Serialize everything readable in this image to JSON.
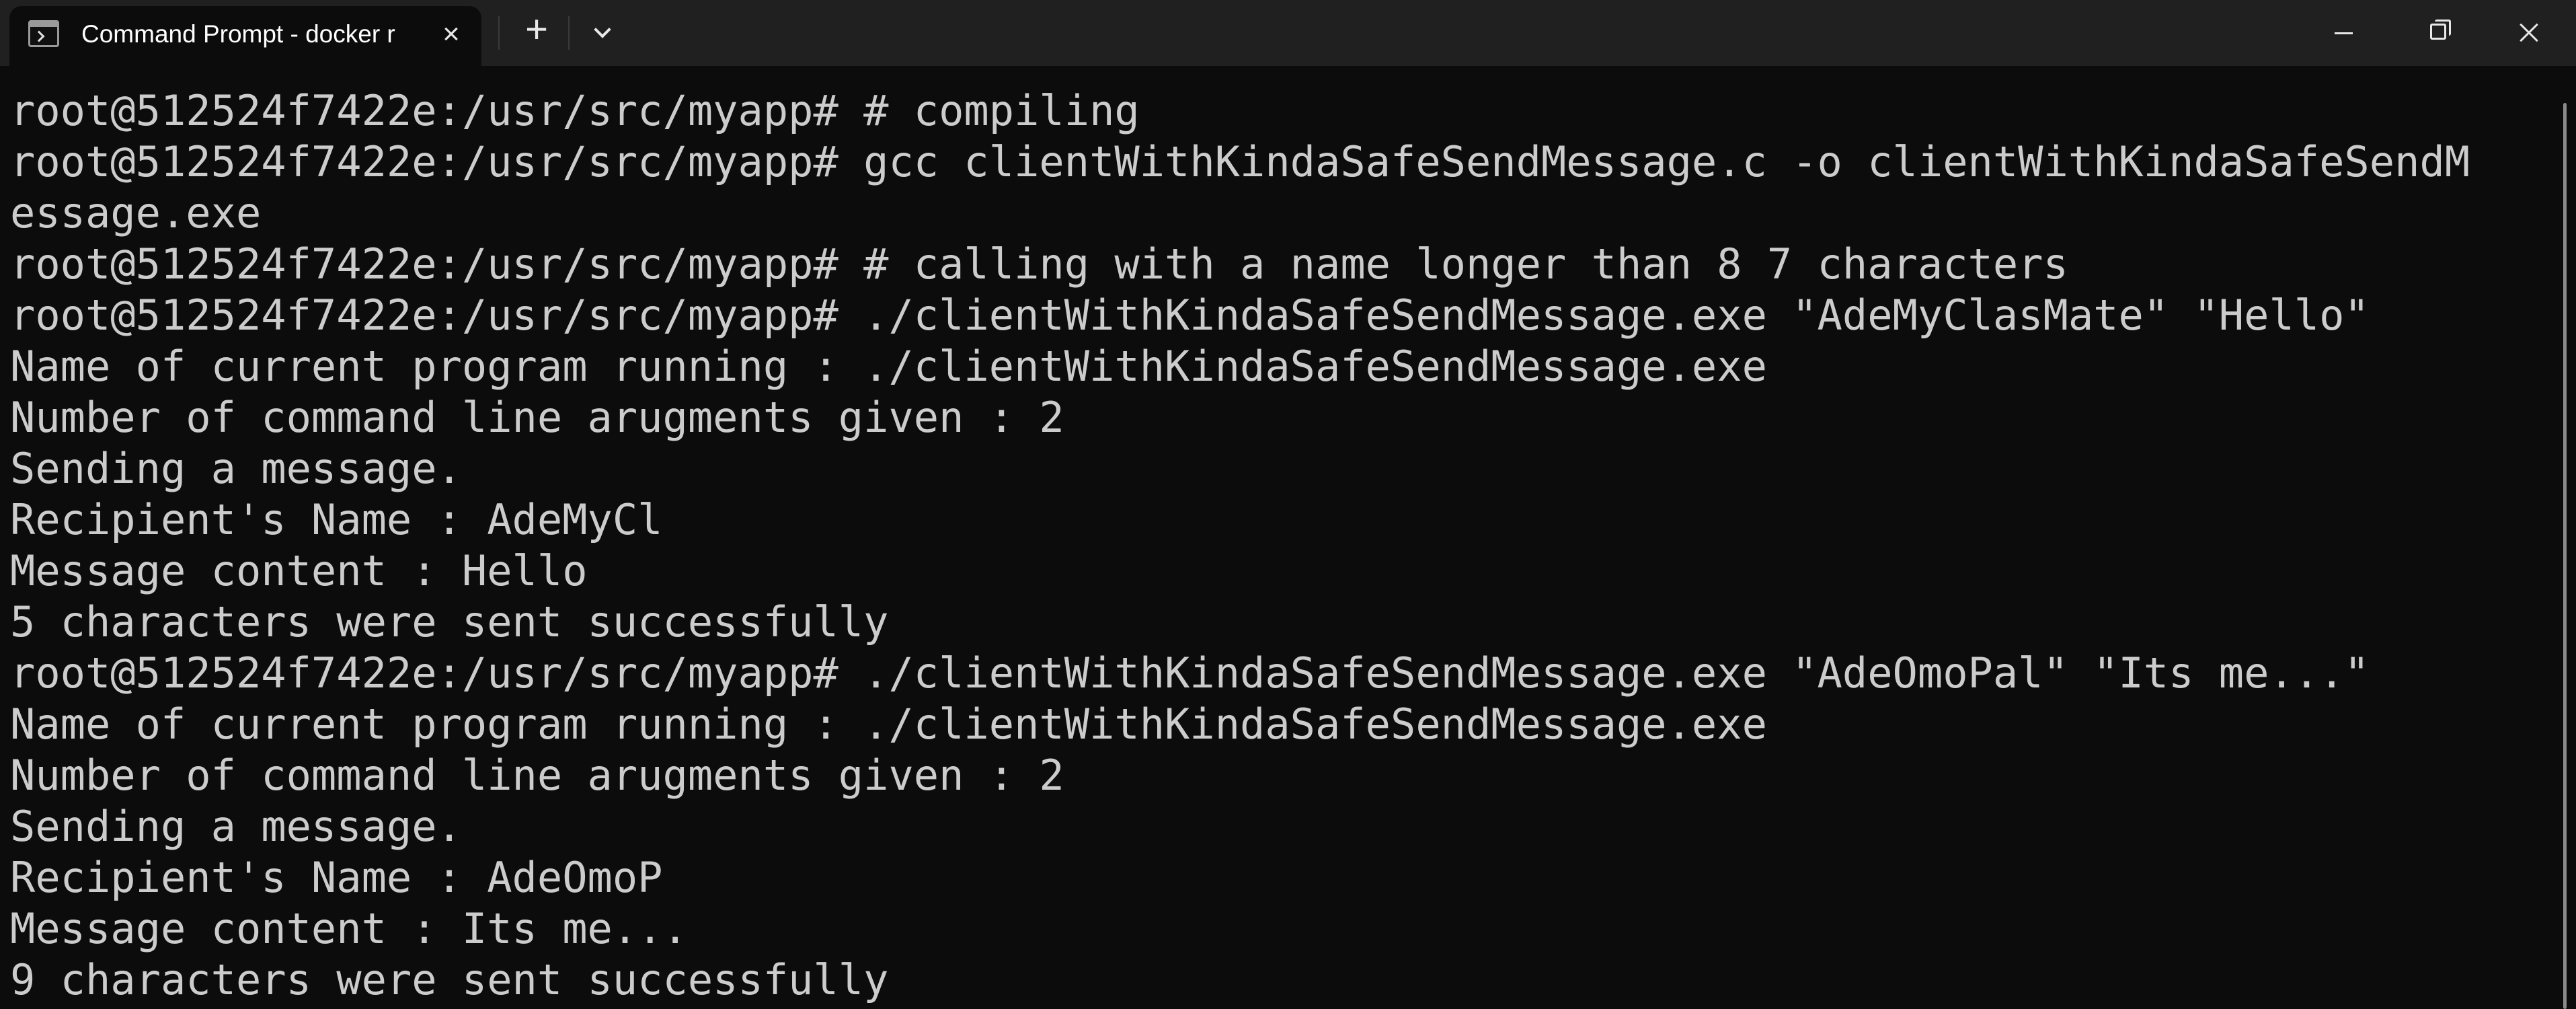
{
  "window": {
    "tab_title": "Command Prompt - docker  r",
    "tab_close_symbol": "×",
    "new_tab_symbol": "+",
    "icons": {
      "app": "terminal-icon",
      "close_tab": "close-icon",
      "new_tab": "plus-icon",
      "dropdown": "chevron-down-icon",
      "minimize": "minimize-icon",
      "maximize": "restore-icon",
      "close_window": "close-icon"
    },
    "colors": {
      "titlebar": "#202020",
      "terminal_background": "#0c0c0c",
      "terminal_text": "#cccccc"
    }
  },
  "terminal": {
    "lines": [
      "root@512524f7422e:/usr/src/myapp# # compiling",
      "root@512524f7422e:/usr/src/myapp# gcc clientWithKindaSafeSendMessage.c -o clientWithKindaSafeSendM",
      "essage.exe",
      "root@512524f7422e:/usr/src/myapp# # calling with a name longer than 8 7 characters",
      "root@512524f7422e:/usr/src/myapp# ./clientWithKindaSafeSendMessage.exe \"AdeMyClasMate\" \"Hello\"",
      "Name of current program running : ./clientWithKindaSafeSendMessage.exe",
      "Number of command line arugments given : 2",
      "Sending a message.",
      "Recipient's Name : AdeMyCl",
      "Message content : Hello",
      "5 characters were sent successfully",
      "root@512524f7422e:/usr/src/myapp# ./clientWithKindaSafeSendMessage.exe \"AdeOmoPal\" \"Its me...\"",
      "Name of current program running : ./clientWithKindaSafeSendMessage.exe",
      "Number of command line arugments given : 2",
      "Sending a message.",
      "Recipient's Name : AdeOmoP",
      "Message content : Its me...",
      "9 characters were sent successfully"
    ]
  }
}
